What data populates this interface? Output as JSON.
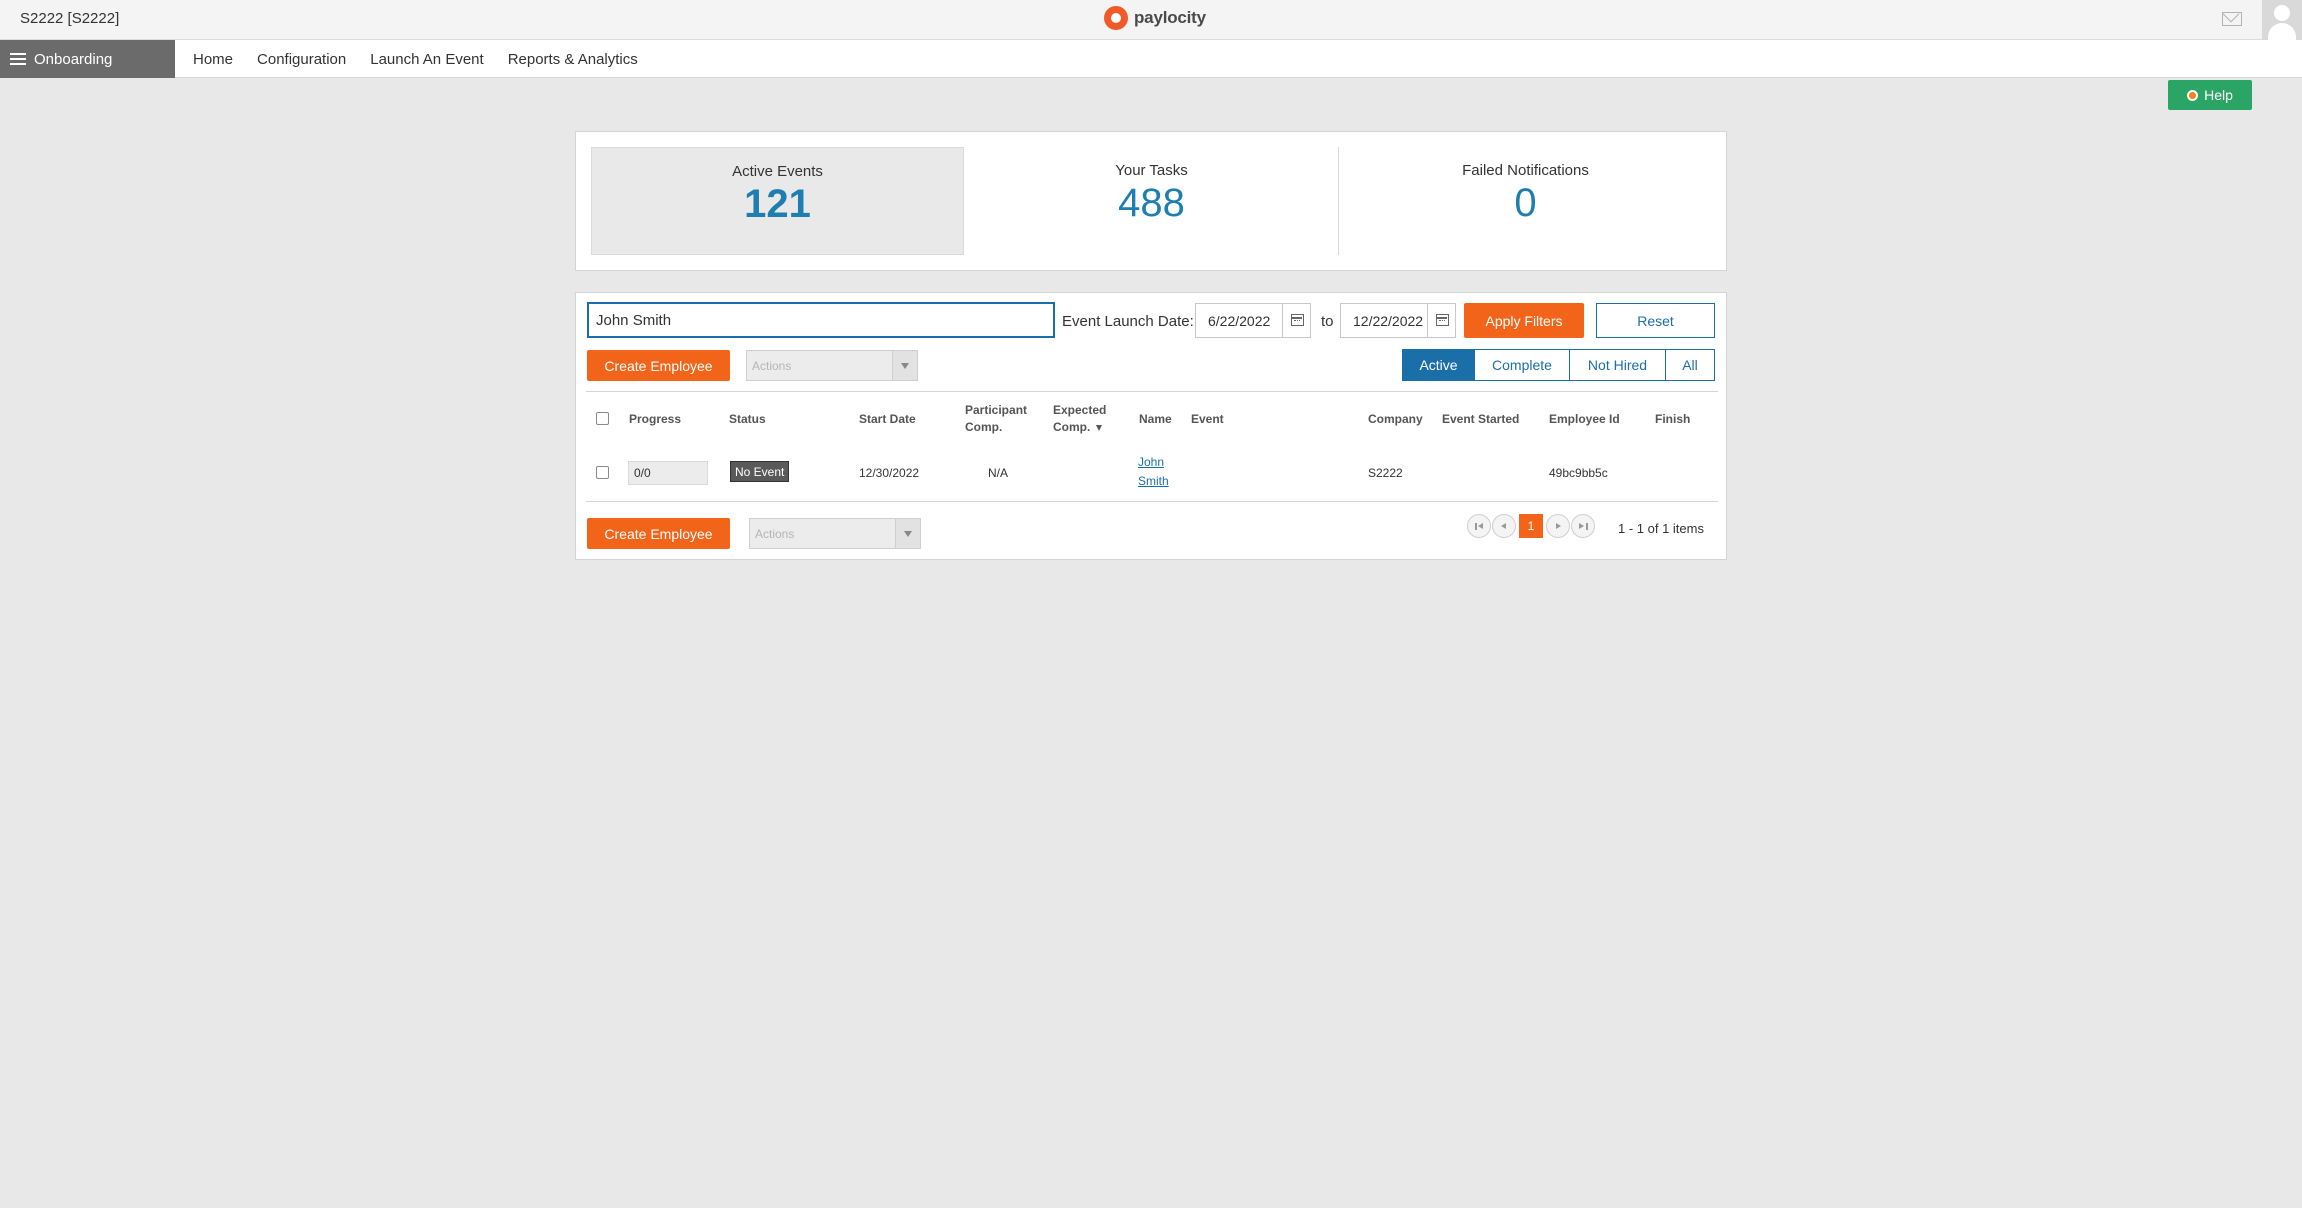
{
  "header": {
    "company": "S2222 [S2222]",
    "brand": "paylocity",
    "mail_icon": "mail-icon",
    "avatar_icon": "user-avatar-icon"
  },
  "nav": {
    "module": "Onboarding",
    "links": [
      "Home",
      "Configuration",
      "Launch An Event",
      "Reports & Analytics"
    ]
  },
  "help": {
    "label": "Help"
  },
  "summary": {
    "active_events": {
      "label": "Active Events",
      "value": "121"
    },
    "your_tasks": {
      "label": "Your Tasks",
      "value": "488"
    },
    "failed_notifications": {
      "label": "Failed Notifications",
      "value": "0"
    }
  },
  "filters": {
    "search_value": "John Smith",
    "launch_label": "Event Launch Date:",
    "date_from": "6/22/2022",
    "to_label": "to",
    "date_to": "12/22/2022",
    "apply_label": "Apply Filters",
    "reset_label": "Reset"
  },
  "toolbar": {
    "create_label": "Create Employee",
    "actions_placeholder": "Actions"
  },
  "tabs": [
    {
      "label": "Active",
      "selected": true
    },
    {
      "label": "Complete",
      "selected": false
    },
    {
      "label": "Not Hired",
      "selected": false
    },
    {
      "label": "All",
      "selected": false
    }
  ],
  "table": {
    "columns": {
      "progress": "Progress",
      "status": "Status",
      "start_date": "Start Date",
      "participant_comp_1": "Participant",
      "participant_comp_2": "Comp.",
      "expected_comp_1": "Expected",
      "expected_comp_2": "Comp.",
      "name": "Name",
      "event": "Event",
      "company": "Company",
      "event_started": "Event Started",
      "employee_id": "Employee Id",
      "finish": "Finish"
    },
    "rows": [
      {
        "progress": "0/0",
        "status": "No Event",
        "start_date": "12/30/2022",
        "participant_comp": "N/A",
        "expected_comp": "",
        "name_first": "John",
        "name_last": "Smith",
        "event": "",
        "company": "S2222",
        "event_started": "",
        "employee_id": "49bc9bb5c",
        "finish": ""
      }
    ]
  },
  "pager": {
    "current_page": "1",
    "items_text": "1 - 1 of 1 items"
  },
  "colors": {
    "accent_blue": "#1b6fa8",
    "orange": "#f26419",
    "green": "#2ba566"
  }
}
